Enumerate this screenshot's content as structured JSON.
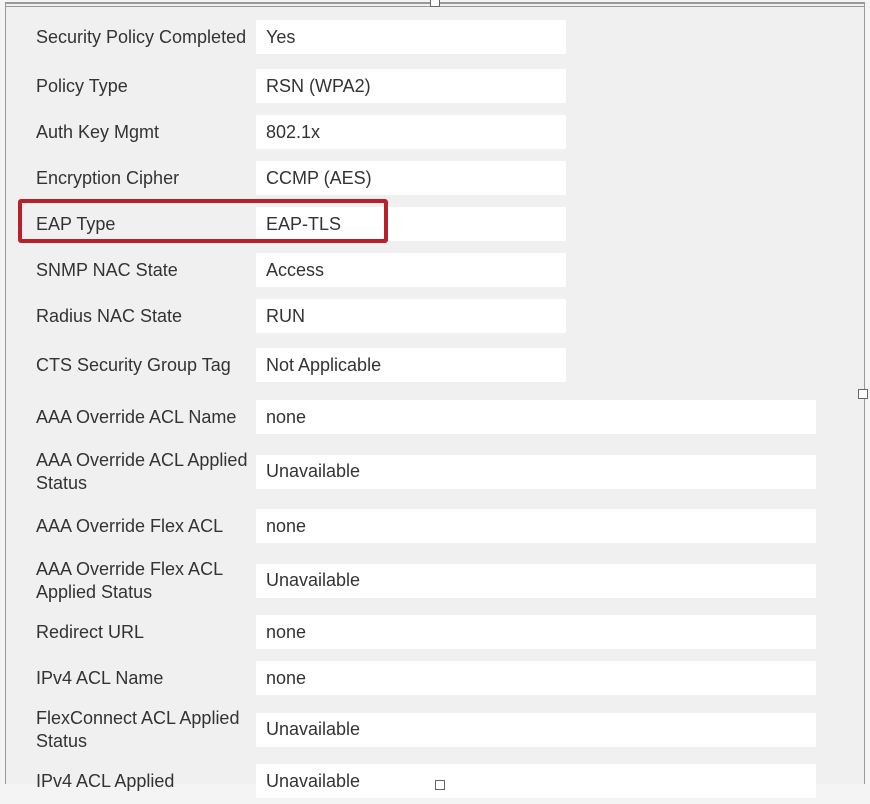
{
  "rows": [
    {
      "label": "Security Policy Completed",
      "value": "Yes",
      "width": "short",
      "twoline": true
    },
    {
      "label": "Policy Type",
      "value": "RSN (WPA2)",
      "width": "short",
      "twoline": false
    },
    {
      "label": "Auth Key Mgmt",
      "value": "802.1x",
      "width": "short",
      "twoline": false
    },
    {
      "label": "Encryption Cipher",
      "value": "CCMP (AES)",
      "width": "short",
      "twoline": false
    },
    {
      "label": "EAP Type",
      "value": "EAP-TLS",
      "width": "short",
      "twoline": false,
      "highlighted": true
    },
    {
      "label": "SNMP NAC State",
      "value": "Access",
      "width": "short",
      "twoline": false
    },
    {
      "label": "Radius NAC State",
      "value": "RUN",
      "width": "short",
      "twoline": false
    },
    {
      "label": "CTS Security Group Tag",
      "value": "Not Applicable",
      "width": "short",
      "twoline": true
    },
    {
      "label": "AAA Override ACL Name",
      "value": "none",
      "width": "long",
      "twoline": true
    },
    {
      "label": "AAA Override ACL Applied Status",
      "value": "Unavailable",
      "width": "long",
      "twoline": true
    },
    {
      "label": "AAA Override Flex ACL",
      "value": "none",
      "width": "long",
      "twoline": true
    },
    {
      "label": "AAA Override Flex ACL Applied Status",
      "value": "Unavailable",
      "width": "long",
      "twoline": true
    },
    {
      "label": "Redirect URL",
      "value": "none",
      "width": "long",
      "twoline": false
    },
    {
      "label": "IPv4 ACL Name",
      "value": "none",
      "width": "long",
      "twoline": false
    },
    {
      "label": "FlexConnect ACL Applied Status",
      "value": "Unavailable",
      "width": "long",
      "twoline": true
    },
    {
      "label": "IPv4 ACL Applied",
      "value": "Unavailable",
      "width": "long",
      "twoline": false
    }
  ]
}
